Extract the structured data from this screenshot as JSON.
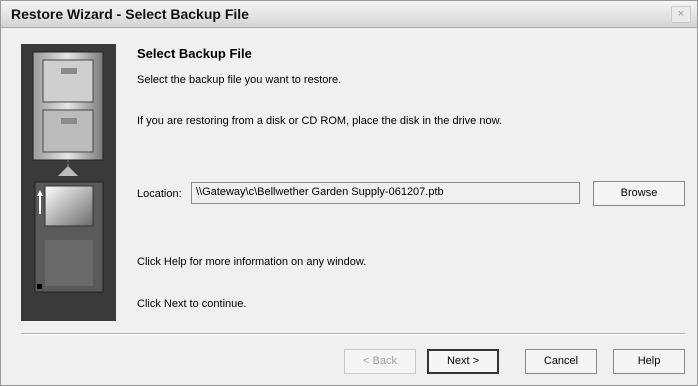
{
  "window": {
    "title": "Restore Wizard - Select Backup File",
    "close_glyph": "×"
  },
  "main": {
    "heading": "Select Backup File",
    "instruction": "Select the backup file you want to restore.",
    "disk_note": "If you are restoring from a disk or CD ROM, place the disk in the drive now.",
    "location_label": "Location:",
    "location_value": "\\\\Gateway\\c\\Bellwether Garden Supply-061207.ptb",
    "browse_label": "Browse",
    "help_note": "Click Help for more information on any window.",
    "next_note": "Click Next to continue."
  },
  "buttons": {
    "back_label": "< Back",
    "next_label": "Next >",
    "cancel_label": "Cancel",
    "help_label": "Help"
  },
  "illustration": {
    "icons": [
      "file-cabinet-icon",
      "floppy-disk-icon"
    ]
  }
}
